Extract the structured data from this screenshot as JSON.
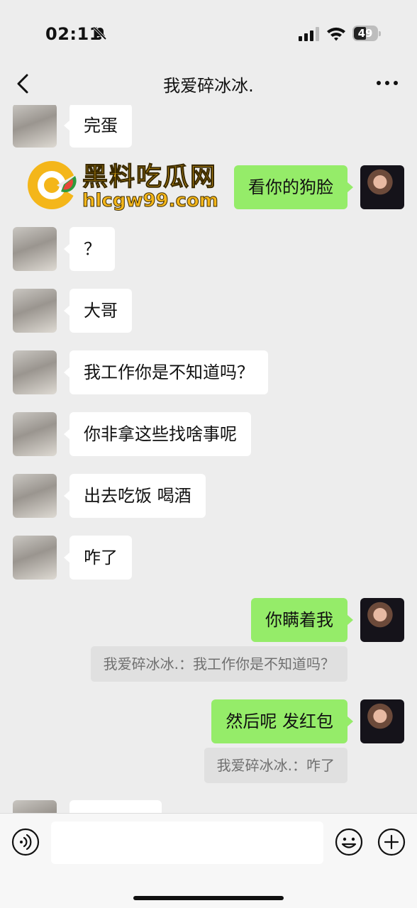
{
  "status_bar": {
    "time": "02:11",
    "battery": "49"
  },
  "nav": {
    "title": "我爱碎冰冰."
  },
  "watermark": {
    "name": "黑料吃瓜网",
    "url": "hlcgw99.com"
  },
  "messages": [
    {
      "side": "in",
      "text": "完蛋"
    },
    {
      "side": "out",
      "text": "看你的狗脸"
    },
    {
      "side": "in",
      "text": "？"
    },
    {
      "side": "in",
      "text": "大哥"
    },
    {
      "side": "in",
      "text": "我工作你是不知道吗？"
    },
    {
      "side": "in",
      "text": "你非拿这些找啥事呢"
    },
    {
      "side": "in",
      "text": "出去吃饭 喝酒"
    },
    {
      "side": "in",
      "text": "咋了"
    },
    {
      "side": "out",
      "text": "你瞒着我",
      "quote": "我爱碎冰冰.：我工作你是不知道吗？"
    },
    {
      "side": "out",
      "text": "然后呢 发红包",
      "quote": "我爱碎冰冰.：咋了"
    }
  ]
}
